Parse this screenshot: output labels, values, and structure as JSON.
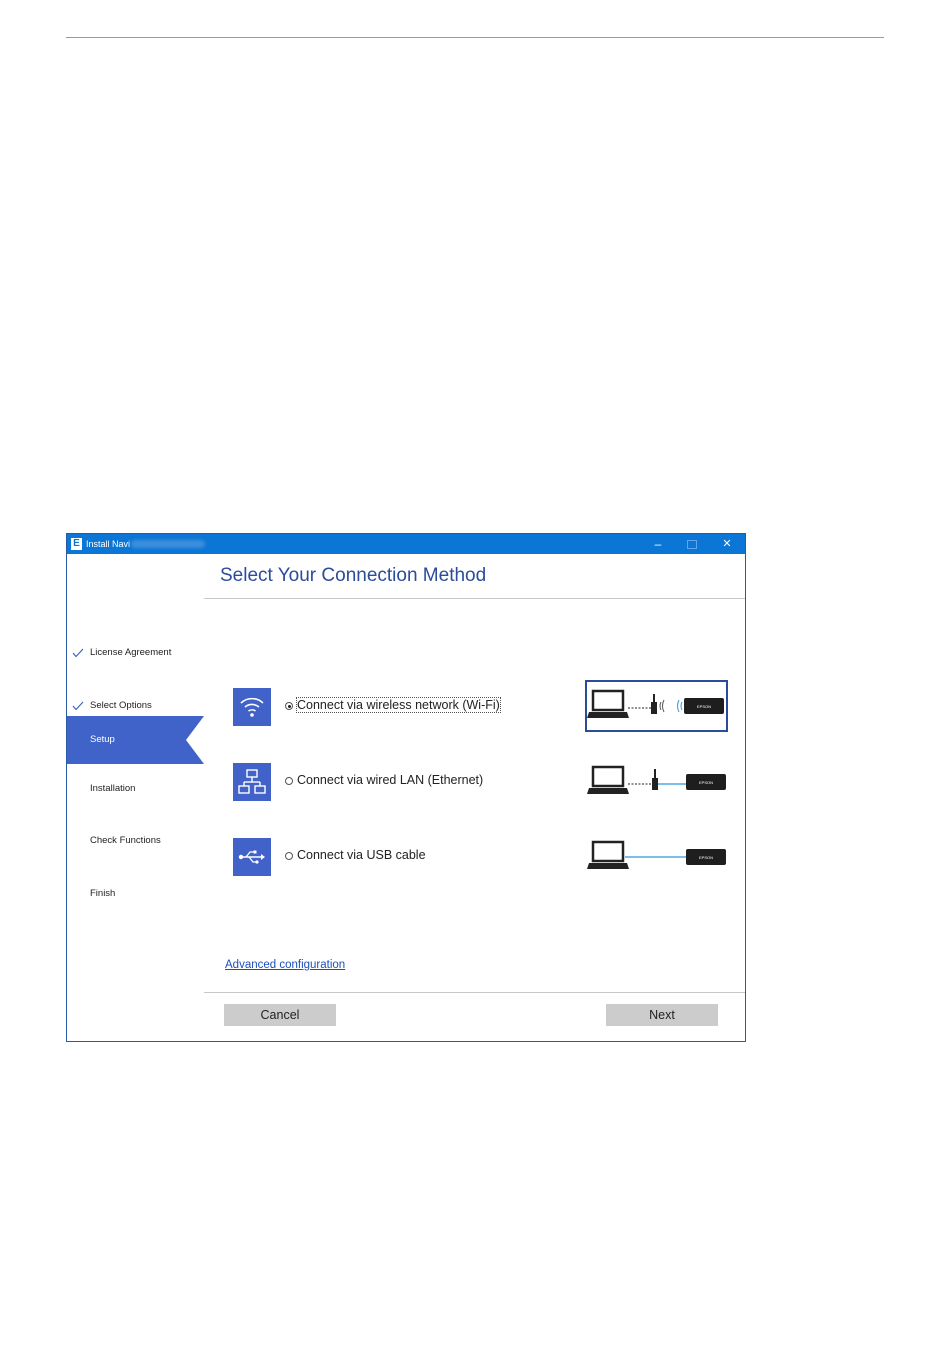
{
  "window": {
    "title": "Install Navi",
    "controls": {
      "minimize": "–",
      "close": "✕"
    }
  },
  "sidebar": {
    "steps": [
      {
        "label": "License Agreement",
        "state": "done"
      },
      {
        "label": "Select Options",
        "state": "done"
      },
      {
        "label": "Setup",
        "state": "active"
      },
      {
        "label": "Installation",
        "state": "pending"
      },
      {
        "label": "Check Functions",
        "state": "pending"
      },
      {
        "label": "Finish",
        "state": "pending"
      }
    ]
  },
  "main": {
    "title": "Select Your Connection Method",
    "options": [
      {
        "label": "Connect via wireless network (Wi-Fi)",
        "icon": "wifi-icon",
        "selected": true
      },
      {
        "label": "Connect via wired LAN (Ethernet)",
        "icon": "network-icon",
        "selected": false
      },
      {
        "label": "Connect via USB cable",
        "icon": "usb-icon",
        "selected": false
      }
    ],
    "printer_label": "EPSON",
    "advanced_link": "Advanced configuration",
    "buttons": {
      "cancel": "Cancel",
      "next": "Next"
    }
  },
  "colors": {
    "titlebar": "#0c76d6",
    "accent": "#3f63c9",
    "heading": "#2b4c9b",
    "link": "#1a4fbf",
    "button": "#cccccc"
  }
}
